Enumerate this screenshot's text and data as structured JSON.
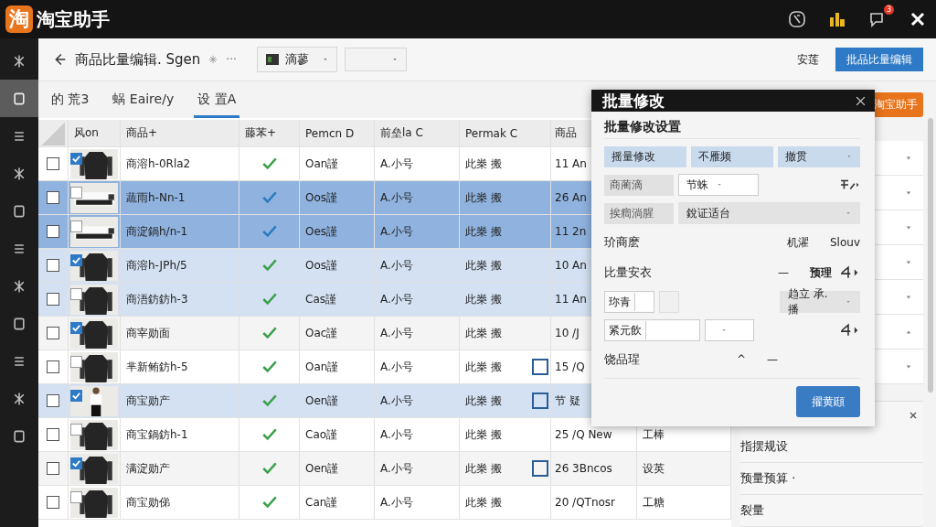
{
  "app": {
    "title": "淘宝助手",
    "logo": "淘",
    "notification_count": "3"
  },
  "toolbar": {
    "title": "商品比量编辑. Sgen",
    "more": "···",
    "dropdown_1": "滴蓼",
    "link": "安莲",
    "primary_button": "批品比量编辑"
  },
  "sidebar": {
    "items": [
      {
        "selected": false
      },
      {
        "selected": true
      },
      {
        "selected": false
      },
      {
        "selected": false
      },
      {
        "selected": false
      },
      {
        "selected": false
      },
      {
        "selected": false
      },
      {
        "selected": false
      },
      {
        "selected": false
      },
      {
        "selected": false
      },
      {
        "selected": false
      }
    ]
  },
  "tabs": [
    {
      "label": "的 荒3",
      "selected": false
    },
    {
      "label": "蜗 Eaire/y",
      "selected": false
    },
    {
      "label": "设 置A",
      "selected": true
    }
  ],
  "table": {
    "columns": [
      "风on",
      "商品+",
      "藤苯+",
      "Pemcn D",
      "前垒la C",
      "Permak C",
      "商品"
    ],
    "rows": [
      {
        "checked": false,
        "image_checked": true,
        "selected": false,
        "highlighted": false,
        "name": "商溶h-0Rla2",
        "verified": true,
        "col_d": "Oan謹",
        "col_c": "A.小号",
        "col_permak": "此桊 搬",
        "flagged": false,
        "goods": "11 An"
      },
      {
        "checked": false,
        "image_checked": false,
        "selected": true,
        "highlighted": false,
        "name": "蔬雨h-Nn-1",
        "verified": true,
        "col_d": "Oos謹",
        "col_c": "A.小号",
        "col_permak": "此桊 搬",
        "flagged": false,
        "goods": "26 An"
      },
      {
        "checked": false,
        "image_checked": false,
        "selected": true,
        "highlighted": false,
        "name": "商淀鍋h/n-1",
        "verified": true,
        "col_d": "Oes謹",
        "col_c": "A.小号",
        "col_permak": "此桊 搬",
        "flagged": false,
        "goods": "11 2n"
      },
      {
        "checked": false,
        "image_checked": true,
        "selected": false,
        "highlighted": true,
        "name": "商溶h-JPh/5",
        "verified": true,
        "col_d": "Oos謹",
        "col_c": "A.小号",
        "col_permak": "此桊 搬",
        "flagged": false,
        "goods": "10 An"
      },
      {
        "checked": false,
        "image_checked": false,
        "selected": false,
        "highlighted": true,
        "name": "商浯鈁鈁h-3",
        "verified": true,
        "col_d": "Cas謹",
        "col_c": "A.小号",
        "col_permak": "此桊 搬",
        "flagged": false,
        "goods": "11 An"
      },
      {
        "checked": false,
        "image_checked": true,
        "selected": false,
        "highlighted": false,
        "name": "商宰勋面",
        "verified": true,
        "col_d": "Oac謹",
        "col_c": "A.小号",
        "col_permak": "此桊 搬",
        "flagged": false,
        "goods": "10 /J"
      },
      {
        "checked": false,
        "image_checked": false,
        "selected": false,
        "highlighted": false,
        "name": "芈新鲔鈁h-5",
        "verified": true,
        "col_d": "Oan謹",
        "col_c": "A.小号",
        "col_permak": "此桊 搬",
        "flagged": true,
        "goods": "15 /Q"
      },
      {
        "checked": false,
        "image_checked": true,
        "selected": false,
        "highlighted": true,
        "name": "商宝勋产",
        "verified": true,
        "col_d": "Oen謹",
        "col_c": "A.小号",
        "col_permak": "此桊 搬",
        "flagged": true,
        "goods": "节 疑"
      },
      {
        "checked": false,
        "image_checked": false,
        "selected": false,
        "highlighted": false,
        "name": "商宝鍋鈁h-1",
        "verified": true,
        "col_d": "Cao謹",
        "col_c": "A.小号",
        "col_permak": "此桊 搬",
        "flagged": false,
        "goods": "25 /Q New",
        "extra": "工棒"
      },
      {
        "checked": false,
        "image_checked": true,
        "selected": false,
        "highlighted": false,
        "name": "满淀勋产",
        "verified": true,
        "col_d": "Oen謹",
        "col_c": "A.小号",
        "col_permak": "此桊 搬",
        "flagged": true,
        "goods": "26 3Bncos",
        "extra": "设英"
      },
      {
        "checked": false,
        "image_checked": false,
        "selected": false,
        "highlighted": false,
        "name": "商宝勋俤",
        "verified": true,
        "col_d": "Can謹",
        "col_c": "A.小号",
        "col_permak": "此桊 搬",
        "flagged": false,
        "goods": "20 /QTnosr",
        "extra": "工糖"
      }
    ]
  },
  "right_panel": {
    "badge_button": "淘宝助手",
    "rows": [
      {
        "expanded": false
      },
      {
        "expanded": false
      },
      {
        "expanded": false
      },
      {
        "expanded": false
      },
      {
        "expanded": false
      },
      {
        "expanded": true
      },
      {
        "expanded": false
      }
    ],
    "list": [
      "指摆规设",
      "预量预算 ·",
      "裂量"
    ]
  },
  "dialog": {
    "title": "批量修改",
    "section": "批量修改设置",
    "chips": [
      "摇量修改",
      "不雁频",
      "撤贯"
    ],
    "row_1": {
      "label": "商蔺滴",
      "select": "节蛛"
    },
    "row_2": {
      "label": "挨癎淌腥",
      "select": "銳证适台"
    },
    "row_3": {
      "label": "玠商麽",
      "middle": "机濯",
      "right": "Slouv"
    },
    "row_4": {
      "label": "比量安衣",
      "dash": "—",
      "right": "预理"
    },
    "row_5": {
      "label": "珎青",
      "select": "趋立 承.播"
    },
    "row_6": {
      "label": "紧元飲"
    },
    "row_7": {
      "label": "饶品瑆",
      "caret": "^",
      "dash": "—"
    },
    "button": "擢黄頲"
  }
}
